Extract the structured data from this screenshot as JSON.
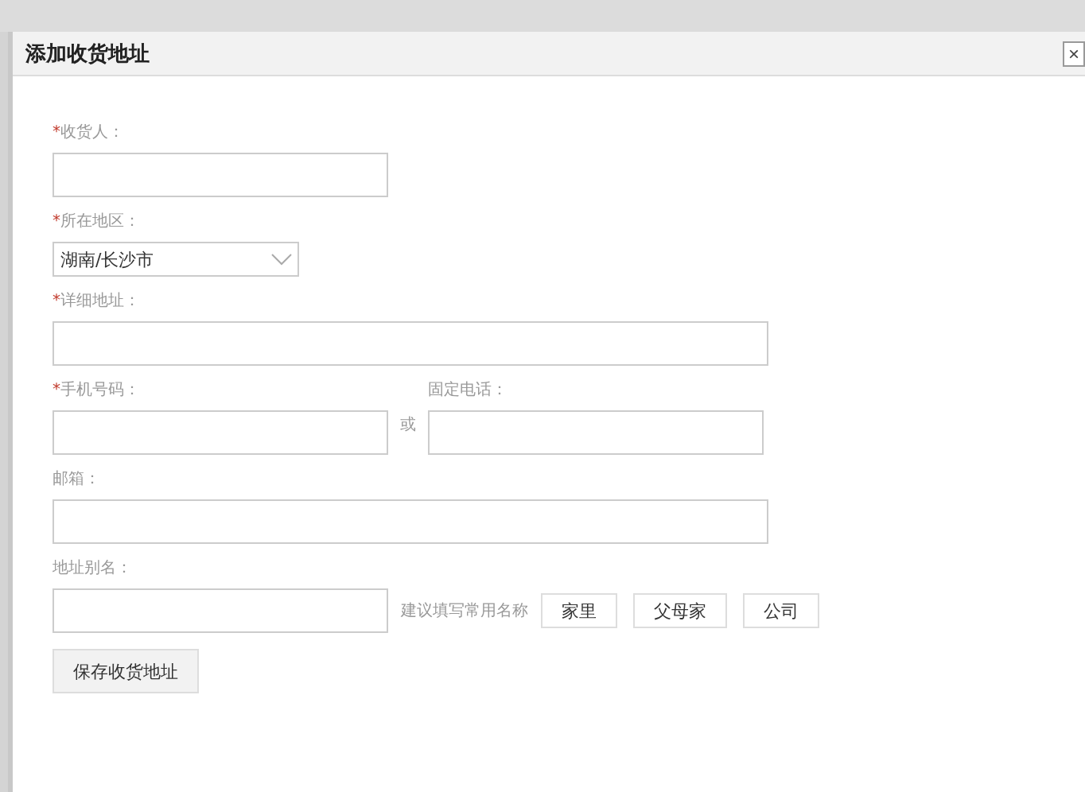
{
  "dialog": {
    "title": "添加收货地址",
    "close": "×"
  },
  "fields": [
    {
      "kind": "text",
      "label": "收货人：",
      "required_mark": "*",
      "wide": false
    },
    {
      "kind": "select",
      "label": "所在地区：",
      "required_mark": "*",
      "value": "湖南/长沙市"
    },
    {
      "kind": "text",
      "label": "详细地址：",
      "required_mark": "*",
      "wide": true
    },
    {
      "kind": "pair",
      "label": "手机号码：",
      "required_mark": "*",
      "separator": "或",
      "second_label": "固定电话："
    },
    {
      "kind": "text",
      "label": "邮箱：",
      "wide": true
    },
    {
      "kind": "alias",
      "label": "地址别名：",
      "hint": "建议填写常用名称",
      "options": [
        "家里",
        "父母家",
        "公司"
      ]
    }
  ],
  "save_button": "保存收货地址"
}
